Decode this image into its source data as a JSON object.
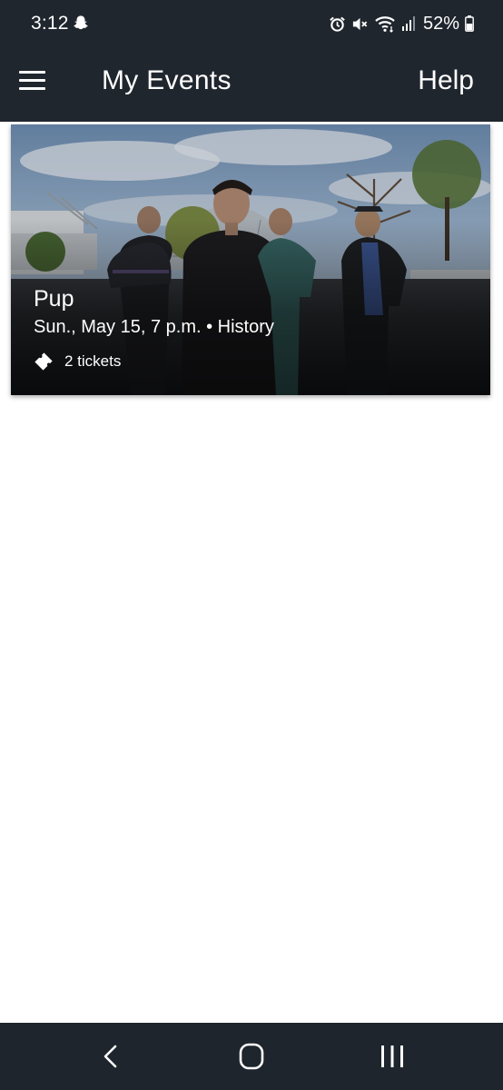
{
  "status_bar": {
    "time": "3:12",
    "battery_percent": "52%",
    "battery_level": 0.52,
    "icons": [
      "snapchat-icon",
      "alarm-icon",
      "mute-icon",
      "wifi-icon",
      "signal-icon",
      "battery-icon"
    ]
  },
  "app_bar": {
    "title": "My Events",
    "help_label": "Help",
    "menu_icon": "hamburger-menu-icon"
  },
  "event": {
    "name": "Pup",
    "details": "Sun., May 15, 7 p.m. • History",
    "tickets": "2 tickets",
    "ticket_icon": "ticket-icon"
  },
  "nav_bar": {
    "icons": [
      "back-icon",
      "home-icon",
      "recents-icon"
    ]
  },
  "colors": {
    "bar_background": "#20262e",
    "page_background": "#ffffff",
    "text_on_dark": "#ffffff"
  }
}
